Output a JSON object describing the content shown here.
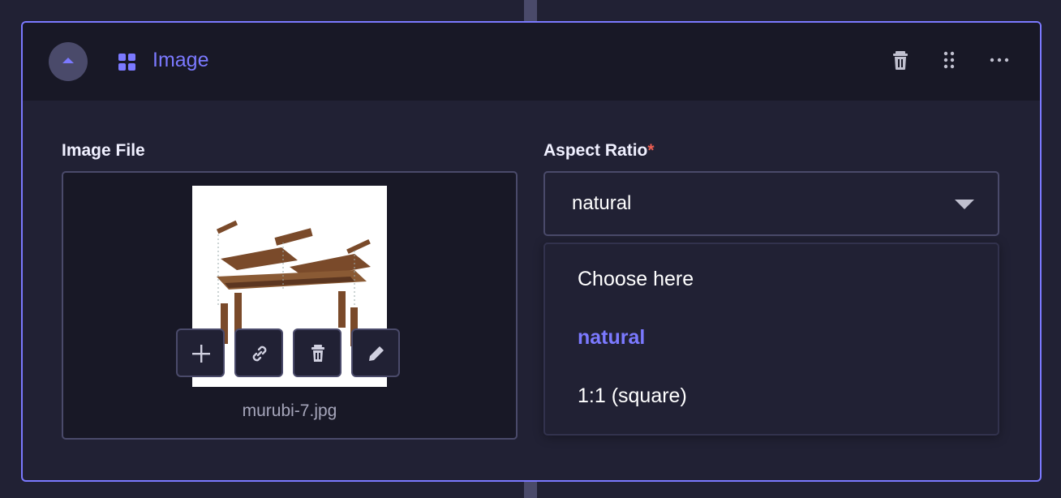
{
  "header": {
    "title": "Image",
    "accent_color": "#7b79ff",
    "icons": [
      "chevron-up-icon",
      "component-grid-icon",
      "trash-icon",
      "drag-handle-icon",
      "more-icon"
    ]
  },
  "fields": {
    "image_file": {
      "label": "Image File",
      "file_name": "murubi-7.jpg",
      "actions": [
        "add-icon",
        "link-icon",
        "trash-icon",
        "pencil-icon"
      ]
    },
    "aspect_ratio": {
      "label": "Aspect Ratio",
      "required_mark": "*",
      "value": "natural",
      "options": [
        "Choose here",
        "natural",
        "1:1 (square)"
      ],
      "selected_index": 1
    }
  }
}
